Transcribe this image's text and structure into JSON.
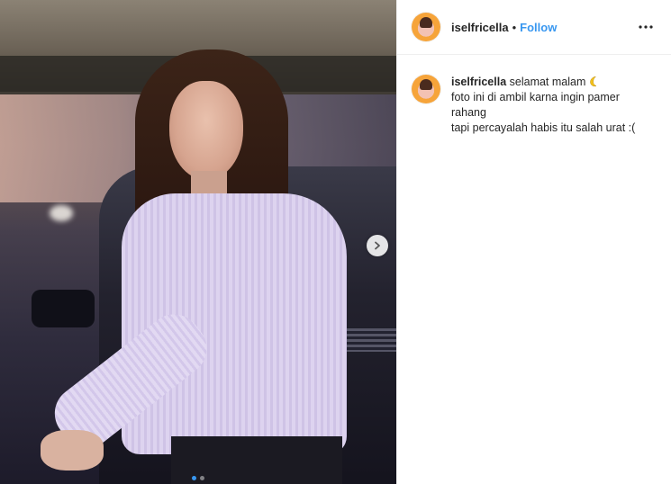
{
  "post": {
    "author": {
      "username": "iselfricella",
      "separator": "•",
      "follow_label": "Follow",
      "avatar_icon": "profile-avatar"
    },
    "header_more_icon": "more-horizontal-icon",
    "caption": {
      "username": "iselfricella",
      "first_line": "selamat malam",
      "emoji_icon": "crescent-moon-emoji",
      "lines": [
        "foto ini di ambil karna ingin pamer",
        "rahang",
        "tapi percayalah habis itu salah urat :("
      ]
    },
    "carousel": {
      "next_icon": "chevron-right-icon",
      "slide_count": 2,
      "active_index": 0,
      "accent_color": "#3897f0"
    }
  }
}
